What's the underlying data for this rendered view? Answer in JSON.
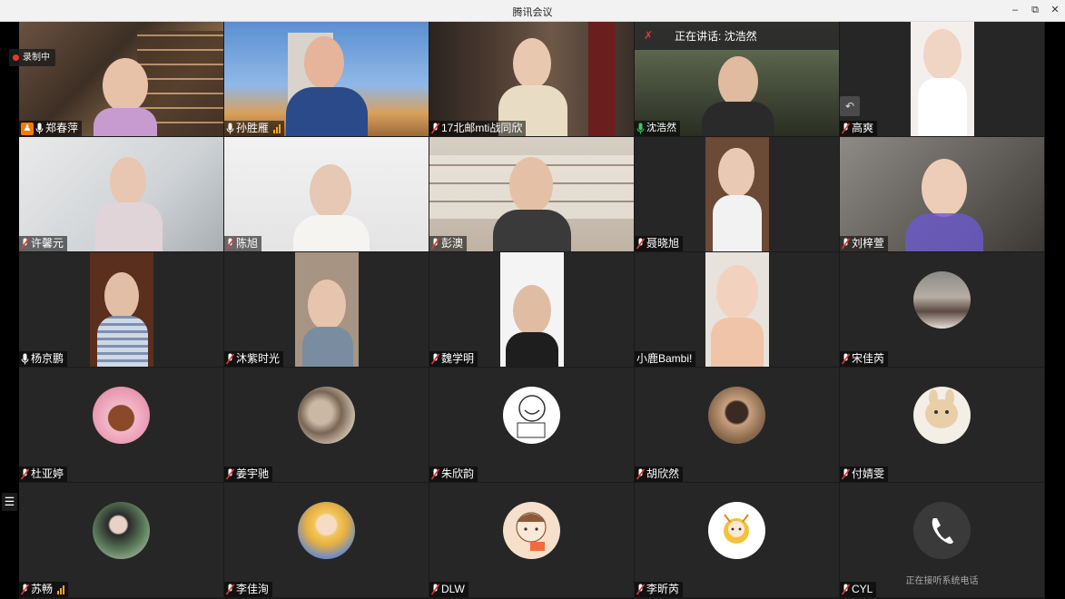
{
  "window": {
    "title": "腾讯会议",
    "minimize_icon": "minimize-icon",
    "restore_icon": "restore-icon",
    "close_icon": "close-icon"
  },
  "recording": {
    "label": "录制中"
  },
  "speaking": {
    "label": "正在讲话: 沈浩然"
  },
  "phone_caption": "正在接听系统电话",
  "participants": [
    {
      "name": "郑春萍",
      "kind": "video",
      "host": true,
      "active": true
    },
    {
      "name": "孙胜雁",
      "kind": "video",
      "signal": true
    },
    {
      "name": "17北邮mti战同欣",
      "kind": "video"
    },
    {
      "name": "沈浩然",
      "kind": "video",
      "speaking": true
    },
    {
      "name": "高爽",
      "kind": "video"
    },
    {
      "name": "许馨元",
      "kind": "video"
    },
    {
      "name": "陈旭",
      "kind": "video"
    },
    {
      "name": "彭澳",
      "kind": "video"
    },
    {
      "name": "聂晓旭",
      "kind": "video"
    },
    {
      "name": "刘梓萱",
      "kind": "video"
    },
    {
      "name": "杨京鹏",
      "kind": "video"
    },
    {
      "name": "沐紫时光",
      "kind": "video"
    },
    {
      "name": "魏学明",
      "kind": "video"
    },
    {
      "name": "小鹿Bambi!",
      "kind": "video"
    },
    {
      "name": "宋佳芮",
      "kind": "avatar"
    },
    {
      "name": "杜亚婷",
      "kind": "avatar"
    },
    {
      "name": "姜宇驰",
      "kind": "avatar"
    },
    {
      "name": "朱欣韵",
      "kind": "avatar"
    },
    {
      "name": "胡欣然",
      "kind": "avatar"
    },
    {
      "name": "付婧雯",
      "kind": "avatar"
    },
    {
      "name": "苏畅",
      "kind": "avatar",
      "signal": true
    },
    {
      "name": "李佳洵",
      "kind": "avatar"
    },
    {
      "name": "DLW",
      "kind": "avatar"
    },
    {
      "name": "李昕芮",
      "kind": "avatar"
    },
    {
      "name": "CYL",
      "kind": "avatar"
    }
  ],
  "colors": {
    "tile_bg": "#262626",
    "active_border": "#2fb36a",
    "signal": "#f5a623",
    "recording_dot": "#e53935"
  }
}
